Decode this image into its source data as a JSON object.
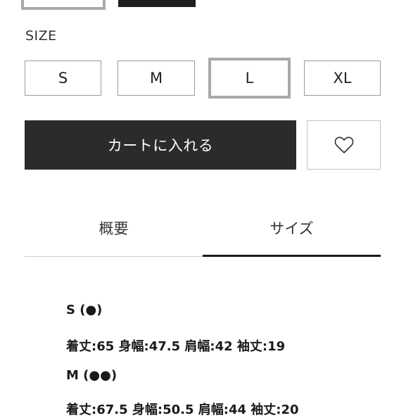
{
  "size_section": {
    "label": "SIZE",
    "options": [
      "S",
      "M",
      "L",
      "XL"
    ],
    "selected": "L"
  },
  "actions": {
    "cart_label": "カートに入れる",
    "favorite_icon": "heart-icon"
  },
  "tabs": [
    {
      "label": "概要",
      "active": false
    },
    {
      "label": "サイズ",
      "active": true
    }
  ],
  "size_details": [
    {
      "size": "S (●)",
      "measurements": "着丈:65 身幅:47.5 肩幅:42 袖丈:19"
    },
    {
      "size": "M (●●)",
      "measurements": "着丈:67.5 身幅:50.5 肩幅:44 袖丈:20"
    }
  ]
}
